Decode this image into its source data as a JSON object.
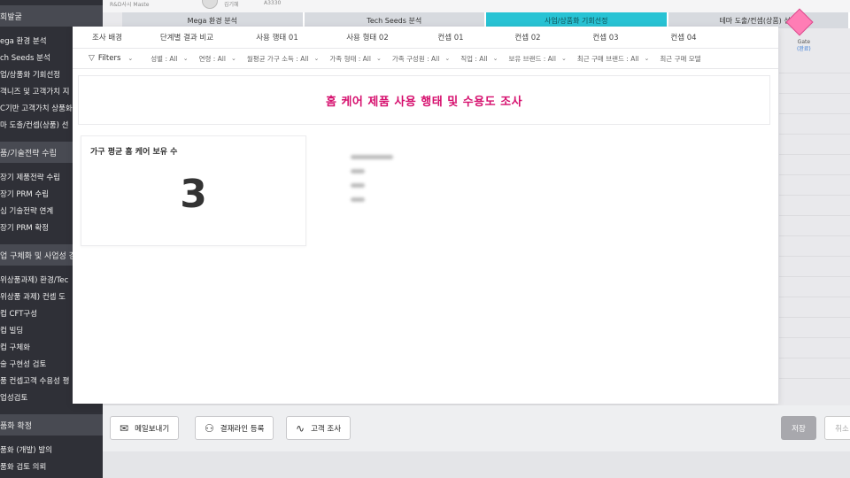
{
  "sidebar": {
    "groups": [
      {
        "section": "회발굴",
        "items": [
          "ega 환경 분석",
          "ch Seeds 분석",
          "업/상품화 기회선정",
          "객니즈 및 고객가치 지",
          "C기반 고객가치 상품화",
          "마 도출/컨셉(상품) 선"
        ]
      },
      {
        "section": "품/기술전략 수립",
        "items": [
          "장기 제품전략 수립",
          "장기 PRM 수립",
          "심 기술전략 연계",
          "장기 PRM 확정"
        ]
      },
      {
        "section": "업 구체화 및 사업성 검",
        "items": [
          "위상품과제) 환경/Tec",
          "위상품 과제) 컨셉 도",
          "컵 CFT구성",
          "컵 빌딩",
          "컵 구체화",
          "술 구현성 검토",
          "품 컨셉고객 수용성 평",
          "업성검토"
        ]
      },
      {
        "section": "품화 확정",
        "items": [
          "품화 (개발) 발의",
          "품화 검토 의뢰"
        ]
      }
    ]
  },
  "background": {
    "user_label": "R&D사시 Maste",
    "name": "김기혜",
    "code": "A3330",
    "stages": [
      "Mega 환경 분석",
      "Tech Seeds 분석",
      "사업/상품화 기회선정",
      "테마 도출/컨셉(상품) 선정"
    ],
    "gate": "Gate",
    "gate_sub": "(완료)",
    "stage_active_color": "#28c3d4",
    "gate_color": "#ff7db5"
  },
  "modal": {
    "tabs": [
      "조사 배경",
      "단계별 결과 비교",
      "사용 행태 01",
      "사용 형태 02",
      "컨셉 01",
      "컨셉 02",
      "컨셉 03",
      "컨셉 04"
    ],
    "filters_label": "Filters",
    "filters": [
      "성별 : All",
      "연령 : All",
      "월평균 가구 소득 : All",
      "가족 형태 : All",
      "가족 구성원 : All",
      "직업 : All",
      "보유 브랜드 : All",
      "최근 구매 브랜드 : All",
      "최근 구매 모델"
    ],
    "title": "홈 케어 제품 사용 행태 및 수용도 조사",
    "title_color": "#d6106e",
    "kpi": {
      "label": "가구 평균 홈 케어 보유 수",
      "value": "3"
    }
  },
  "actions": {
    "email": "메일보내기",
    "approval": "결재라인 등록",
    "survey": "고객 조사",
    "save": "저장",
    "cancel": "취소"
  }
}
